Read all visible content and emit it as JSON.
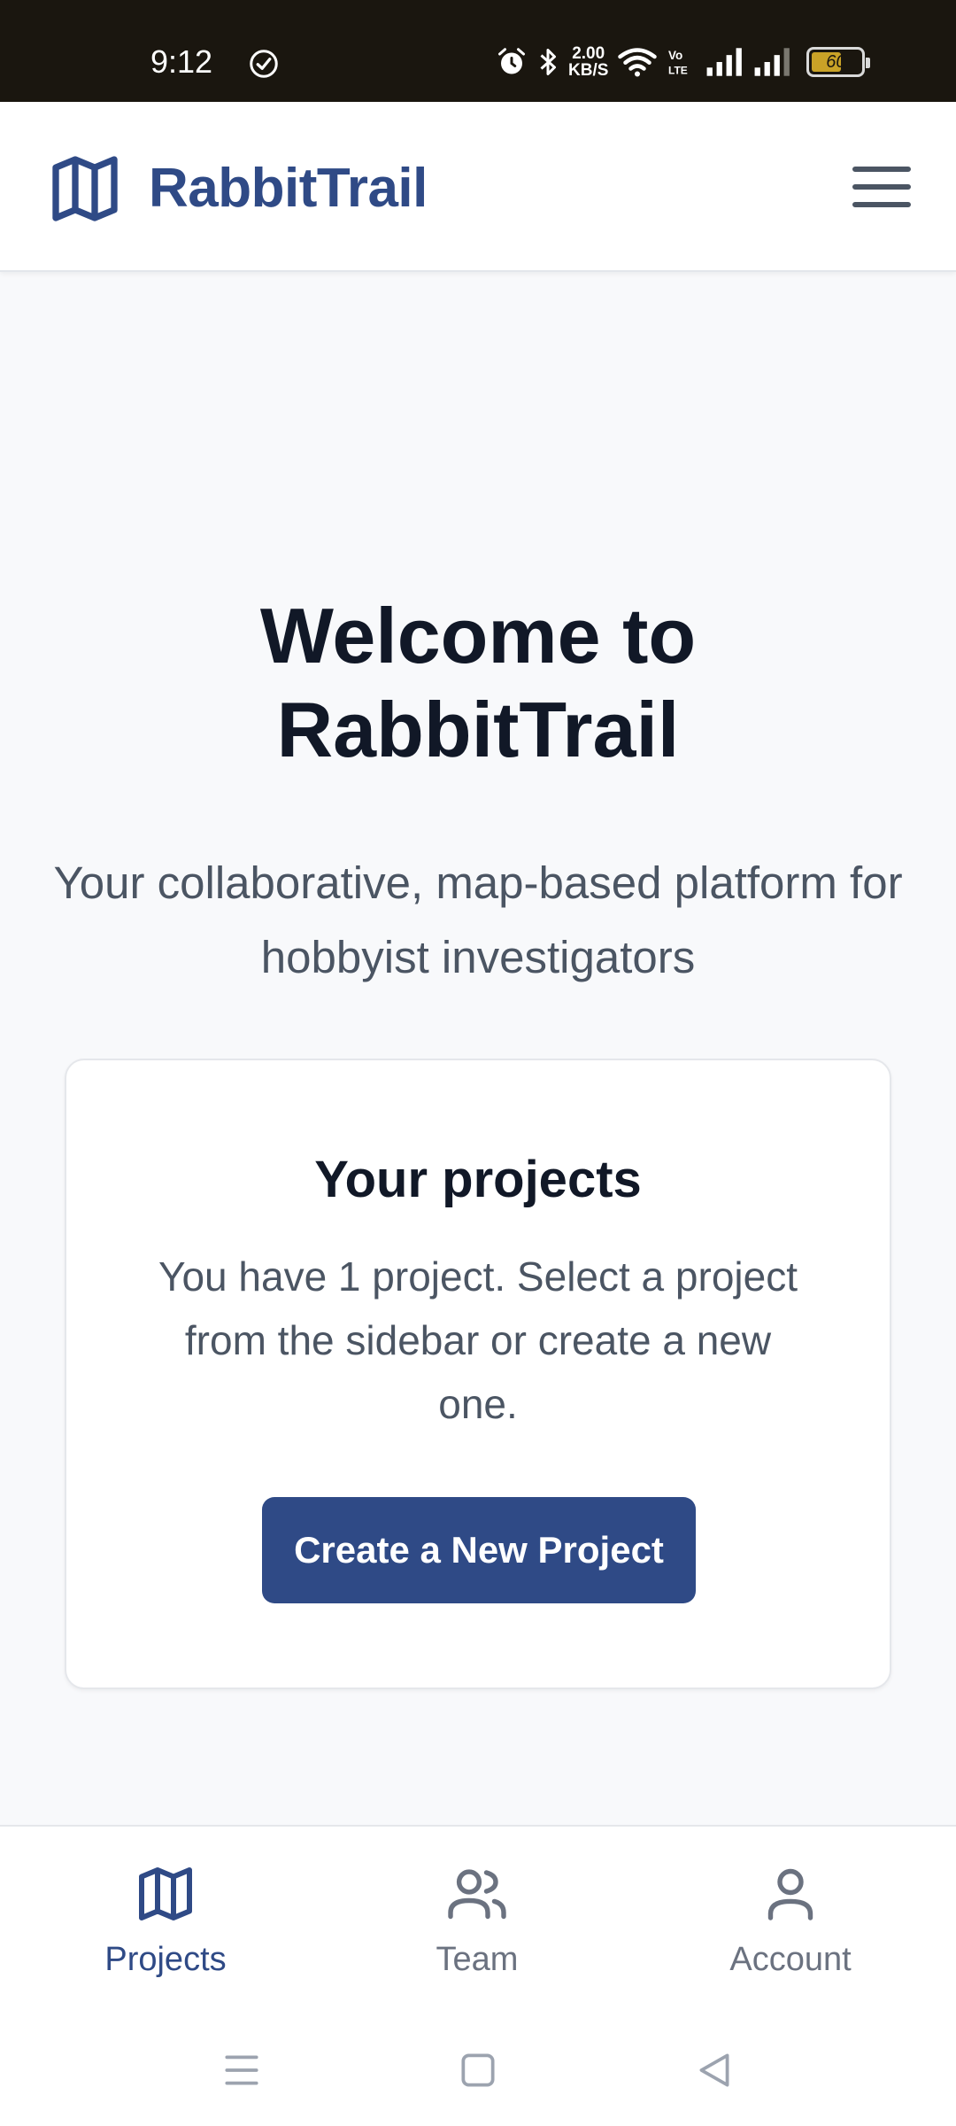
{
  "status_bar": {
    "time": "9:12",
    "net_speed_value": "2.00",
    "net_speed_unit": "KB/S",
    "battery_percent": "60",
    "battery_level": 0.6,
    "icons": [
      "check-circle-icon",
      "alarm-icon",
      "bluetooth-icon",
      "wifi-icon",
      "volte-icon",
      "signal-icon",
      "signal-icon",
      "battery-icon"
    ]
  },
  "header": {
    "brand": "RabbitTrail",
    "logo_icon": "map-icon",
    "menu_icon": "hamburger-menu-icon"
  },
  "hero": {
    "title": "Welcome to RabbitTrail",
    "subtitle": "Your collaborative, map-based platform for hobbyist investigators"
  },
  "projects_card": {
    "title": "Your projects",
    "text": "You have 1 project. Select a project from the sidebar or create a new one.",
    "button_label": "Create a New Project"
  },
  "bottom_nav": {
    "items": [
      {
        "label": "Projects",
        "icon": "map-icon",
        "active": true
      },
      {
        "label": "Team",
        "icon": "users-icon",
        "active": false
      },
      {
        "label": "Account",
        "icon": "user-icon",
        "active": false
      }
    ]
  },
  "system_nav": [
    "recents-icon",
    "home-icon",
    "back-icon"
  ],
  "colors": {
    "brand": "#2f4a86",
    "inactive": "#6b7280",
    "heading": "#111827",
    "body_text": "#4b5563",
    "background": "#f8f9fb",
    "status_bar": "#1a160f"
  }
}
